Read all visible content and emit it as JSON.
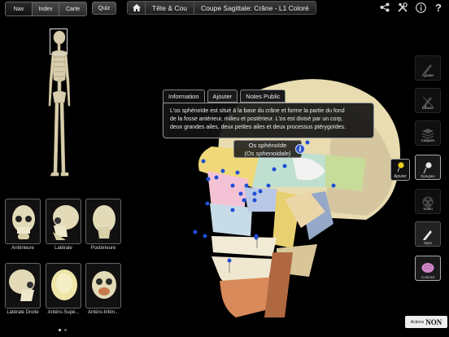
{
  "nav": {
    "tabs": [
      {
        "label": "Nav",
        "active": true
      },
      {
        "label": "Index",
        "active": false
      },
      {
        "label": "Carte",
        "active": false
      }
    ],
    "quiz_label": "Quiz"
  },
  "breadcrumb": {
    "items": [
      "Tête & Cou",
      "Coupe Sagittale: Crâne - L1 Coloré"
    ]
  },
  "top_icons": [
    "share-icon",
    "tools-icon",
    "info-icon",
    "help-icon"
  ],
  "views": [
    {
      "label": "Antérieure"
    },
    {
      "label": "Latérale"
    },
    {
      "label": "Postérieure"
    },
    {
      "label": "Latérale Droite"
    },
    {
      "label": "Antéro-Supé..."
    },
    {
      "label": "Antéro-Inféri..."
    }
  ],
  "page_dots": {
    "count": 2,
    "active": 0
  },
  "info_panel": {
    "tabs": [
      {
        "label": "Information",
        "active": true
      },
      {
        "label": "Ajouter",
        "active": false
      },
      {
        "label": "Notes Public",
        "active": false
      }
    ],
    "text_lines": [
      "L'os sphénoïde est situé à la base du crâne et forme la partie du fond",
      "de la fosse antérieur, milieu et postérieur. L'os est divisé par un corp,",
      "deux grandes ailes, deux petites ailes et deux processus ptérygoïdes."
    ]
  },
  "structure_label": {
    "name": "Os sphénoïde",
    "latin": "(Os sphenoidale)"
  },
  "right_toolbar": [
    {
      "label": "Ajouter",
      "icon": "pen-icon",
      "state": "disabled"
    },
    {
      "label": "Effacer",
      "icon": "eraser-icon",
      "state": "disabled"
    },
    {
      "label": "Calques",
      "icon": "layers-icon",
      "state": "disabled"
    },
    {
      "label": "Épingles",
      "icon": "pin-icon",
      "state": "selected"
    },
    {
      "label": "Vidéo",
      "icon": "film-icon",
      "state": "disabled"
    },
    {
      "label": "Stylo",
      "icon": "pencil-icon",
      "state": "normal"
    },
    {
      "label": "Colored",
      "icon": "brain-icon",
      "state": "selected"
    }
  ],
  "pin_popup_label": "Ajouter",
  "brand": {
    "prefix": "Actions",
    "name": "NON"
  },
  "colors": {
    "background": "#000000",
    "pin_blue": "#1f4fd6",
    "pin_yellow": "#f0d020",
    "accent_info": "#2c54c9"
  }
}
